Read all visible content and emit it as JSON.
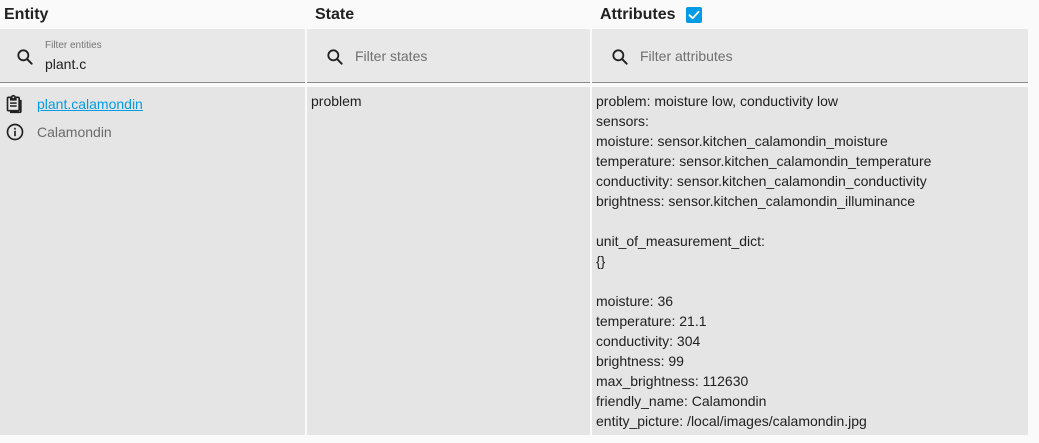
{
  "header": {
    "entity_label": "Entity",
    "state_label": "State",
    "attributes_label": "Attributes",
    "attributes_checked": true
  },
  "filters": {
    "entity": {
      "label": "Filter entities",
      "value": "plant.c",
      "icon": "search-icon"
    },
    "state": {
      "placeholder": "Filter states",
      "icon": "search-icon"
    },
    "attributes": {
      "placeholder": "Filter attributes",
      "icon": "search-icon"
    }
  },
  "row": {
    "entity_id": "plant.calamondin",
    "friendly_name": "Calamondin",
    "entity_icon": "clipboard-icon",
    "info_icon": "info-icon",
    "state": "problem",
    "attributes": [
      "problem: moisture low, conductivity low",
      "sensors:",
      "moisture: sensor.kitchen_calamondin_moisture",
      "temperature: sensor.kitchen_calamondin_temperature",
      "conductivity: sensor.kitchen_calamondin_conductivity",
      "brightness: sensor.kitchen_calamondin_illuminance",
      "",
      "unit_of_measurement_dict:",
      "{}",
      "",
      "moisture: 36",
      "temperature: 21.1",
      "conductivity: 304",
      "brightness: 99",
      "max_brightness: 112630",
      "friendly_name: Calamondin",
      "entity_picture: /local/images/calamondin.jpg"
    ]
  },
  "colors": {
    "link": "#039be5",
    "checkbox": "#039be5",
    "cell_bg": "#e5e5e5",
    "filter_bg": "#e8e8e8"
  }
}
